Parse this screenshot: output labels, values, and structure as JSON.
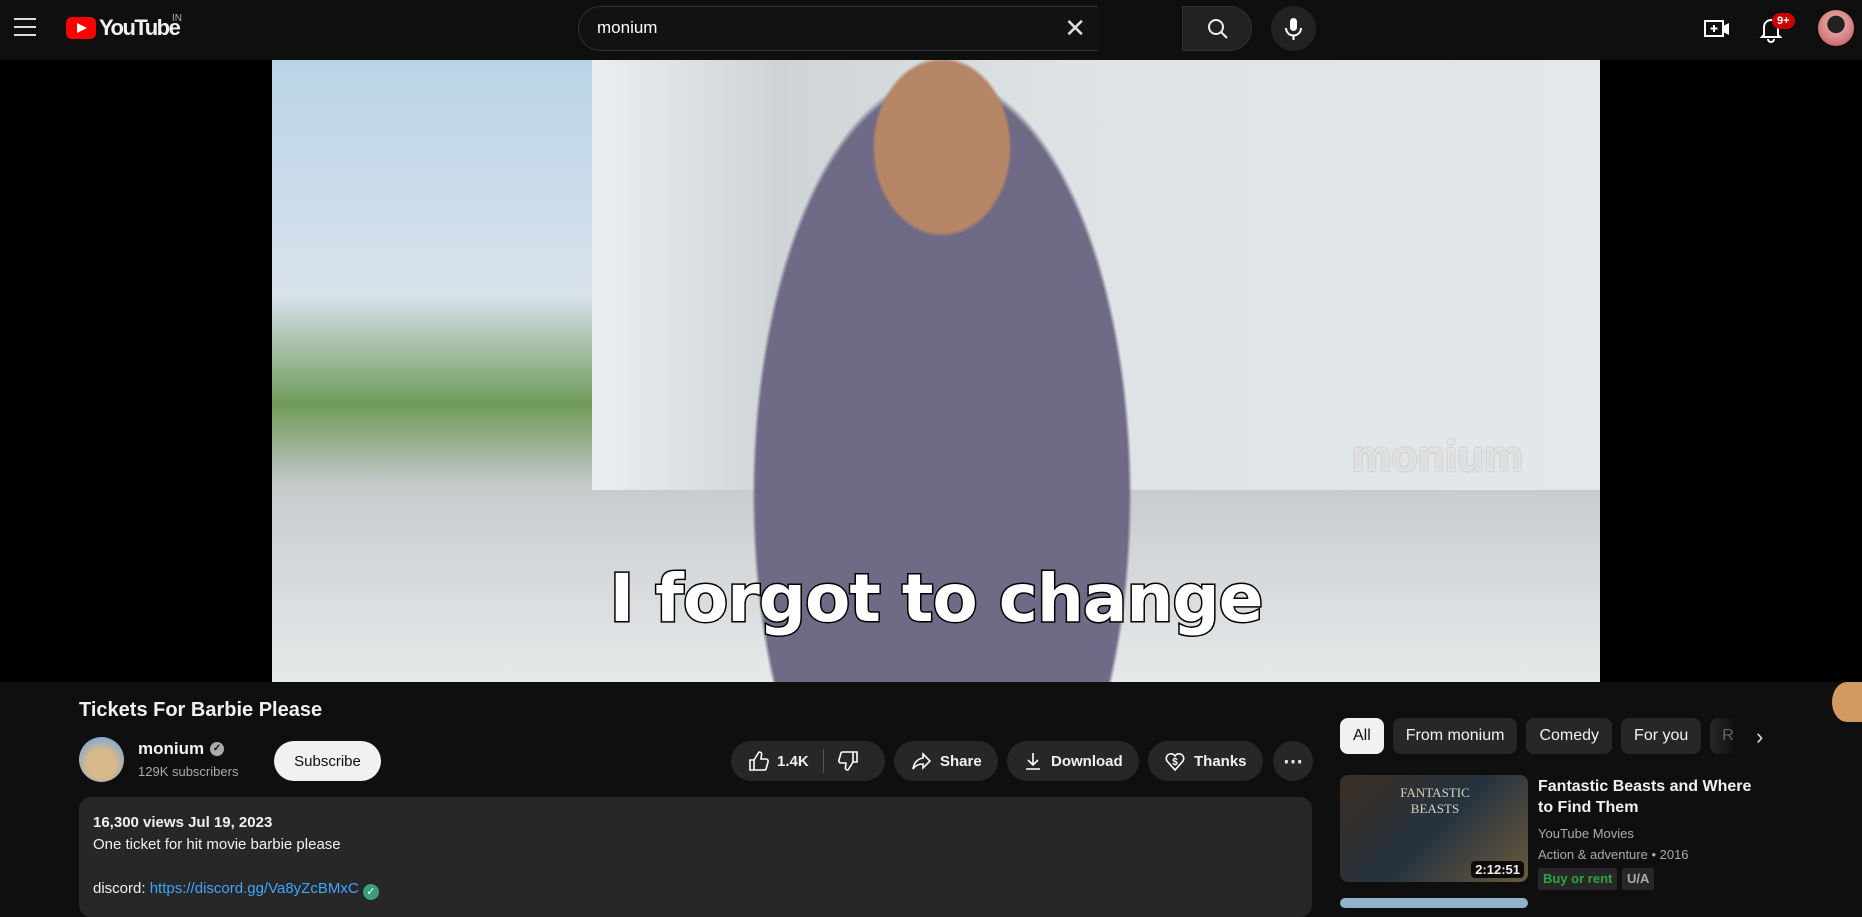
{
  "header": {
    "logo_text": "YouTube",
    "country": "IN",
    "search_value": "monium",
    "notification_badge": "9+"
  },
  "video": {
    "subtitle": "I forgot to change",
    "watermark": "monium"
  },
  "info": {
    "title": "Tickets For Barbie Please",
    "channel": "monium",
    "subscribers": "129K subscribers",
    "subscribe_label": "Subscribe",
    "likes": "1.4K",
    "share_label": "Share",
    "download_label": "Download",
    "thanks_label": "Thanks"
  },
  "description": {
    "stats": "16,300 views  Jul 19, 2023",
    "line1": "One ticket for hit movie barbie please",
    "discord_label": "discord:",
    "discord_link": "https://discord.gg/Va8yZcBMxC"
  },
  "chips": [
    "All",
    "From monium",
    "Comedy",
    "For you",
    "R"
  ],
  "recommended": [
    {
      "title": "Fantastic Beasts and Where to Find Them",
      "channel": "YouTube Movies",
      "meta": "Action & adventure • 2016",
      "duration": "2:12:51",
      "buy": "Buy or rent",
      "rating": "U/A",
      "poster_text": "FANTASTIC BEASTS"
    }
  ],
  "colors": {
    "brand": "#ff0000",
    "link": "#3ea6ff",
    "buy": "#2ba640"
  }
}
